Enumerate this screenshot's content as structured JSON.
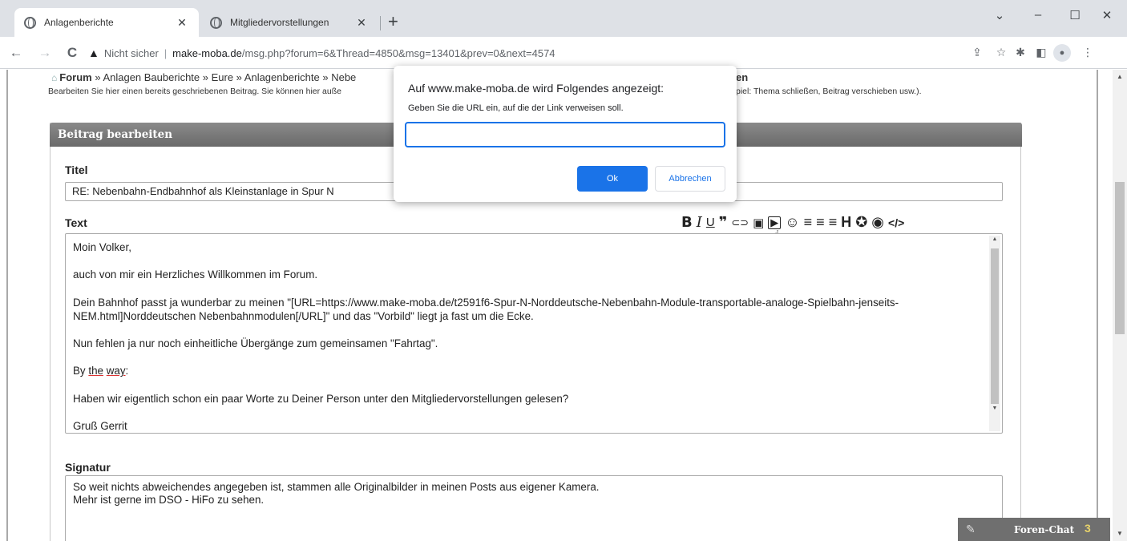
{
  "browser": {
    "tabs": [
      {
        "title": "Anlagenberichte",
        "close": "✕"
      },
      {
        "title": "Mitgliedervorstellungen",
        "close": "✕"
      }
    ],
    "new_tab": "+",
    "window_controls": {
      "dropdown": "⌄",
      "minimize": "–",
      "maximize": "☐",
      "close": "✕"
    },
    "nav": {
      "back": "←",
      "forward": "→",
      "reload": "C"
    },
    "security_text": "Nicht sicher",
    "url_host": "make-moba.de",
    "url_path": "/msg.php?forum=6&Thread=4850&msg=13401&prev=0&next=4574",
    "toolbar_icons": {
      "share": "⇪",
      "bookmark": "☆",
      "extensions": "✱",
      "sidepanel": "◧",
      "menu": "⋮"
    }
  },
  "page": {
    "breadcrumb": {
      "forum": "Forum",
      "rest": " » Anlagen Bauberichte » Eure » Anlagenberichte » Nebe",
      "tail": "en"
    },
    "subtext": "Bearbeiten Sie hier einen bereits geschriebenen Beitrag. Sie können hier auße",
    "subtext_tail": "piel: Thema schließen, Beitrag verschieben usw.).",
    "panel_header": "Beitrag bearbeiten",
    "title_label": "Titel",
    "title_value": "RE: Nebenbahn-Endbahnhof als Kleinstanlage in Spur N",
    "text_label": "Text",
    "editor_tools": {
      "bold": "B",
      "italic": "I",
      "underline": "U",
      "quote": "❞",
      "link": "⊂⊃",
      "image": "▣",
      "video": "▶",
      "smiley": "☺",
      "align_left": "≡",
      "align_center": "≡",
      "align_right": "≡",
      "heading": "H",
      "color": "✪",
      "preview": "◉",
      "code": "</>"
    },
    "text_lines": {
      "l1": "Moin Volker,",
      "l2": "auch von mir ein Herzliches Willkommen im Forum.",
      "l3a": "Dein Bahnhof passt ja wunderbar zu meinen \"[URL=https://www.make-moba.de/t2591f6-Spur-N-Norddeutsche-Nebenbahn-Module-transportable-analoge-Spielbahn-jenseits-",
      "l3b": "NEM.html]Norddeutschen Nebenbahnmodulen[/URL]\" und das \"Vorbild\" liegt ja fast um die Ecke.",
      "l4": "Nun fehlen ja nur noch einheitliche Übergänge zum gemeinsamen \"Fahrtag\".",
      "l5_by": "By ",
      "l5_the": "the",
      "l5_sp": " ",
      "l5_way": "way",
      "l5_colon": ":",
      "l6": "Haben wir eigentlich schon ein paar Worte zu Deiner Person unter den Mitgliedervorstellungen gelesen?",
      "l7": "Gruß Gerrit"
    },
    "signature_label": "Signatur",
    "signature_lines": [
      "So weit nichts abweichendes angegeben ist, stammen alle Originalbilder in meinen Posts aus eigener Kamera.",
      "Mehr ist gerne im DSO - HiFo zu sehen."
    ],
    "chat": {
      "label": "Foren-Chat",
      "count": "3"
    }
  },
  "dialog": {
    "title": "Auf www.make-moba.de wird Folgendes angezeigt:",
    "message": "Geben Sie die URL ein, auf die der Link verweisen soll.",
    "input_value": "",
    "ok": "Ok",
    "cancel": "Abbrechen"
  },
  "colors": {
    "accent": "#1a73e8",
    "panel_header": "#777777",
    "tabbar": "#dee1e6"
  }
}
